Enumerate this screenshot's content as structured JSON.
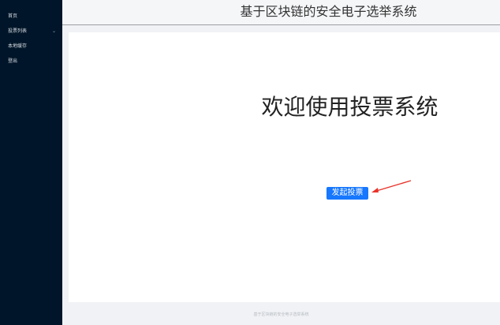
{
  "sidebar": {
    "items": [
      {
        "label": "首页"
      },
      {
        "label": "投票列表",
        "chevron": "chevron-down-icon"
      },
      {
        "label": "本地缓存"
      },
      {
        "label": "登出"
      }
    ]
  },
  "header": {
    "title": "基于区块链的安全电子选举系统"
  },
  "main": {
    "welcome": "欢迎使用投票系统",
    "start_button": "发起投票"
  },
  "footer": {
    "text": "基于区块链的安全电子选举系统"
  },
  "colors": {
    "sidebar_bg": "#001529",
    "primary": "#1677ff",
    "annotation_arrow": "#e8332a"
  }
}
